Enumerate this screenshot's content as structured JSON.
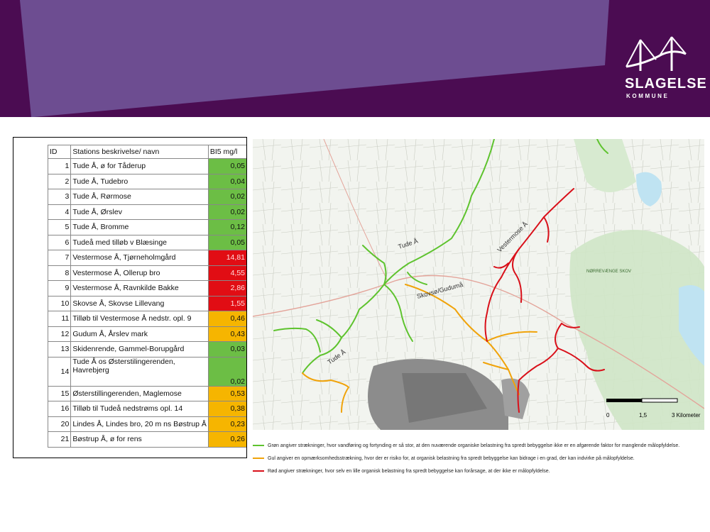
{
  "brand": {
    "name": "SLAGELSE",
    "sub": "KOMMUNE",
    "colors": {
      "header_dark": "#4b0c52",
      "header_light": "#6d4d91"
    }
  },
  "table": {
    "headers": [
      "ID",
      "Stations beskrivelse/ navn",
      "BI5 mg/l"
    ],
    "rows": [
      {
        "id": "1",
        "desc": "Tude Å, ø for Tåderup",
        "val": "0,05",
        "status": "green"
      },
      {
        "id": "2",
        "desc": "Tude Å, Tudebro",
        "val": "0,04",
        "status": "green"
      },
      {
        "id": "3",
        "desc": "Tude Å, Rørmose",
        "val": "0,02",
        "status": "green"
      },
      {
        "id": "4",
        "desc": "Tude Å, Ørslev",
        "val": "0,02",
        "status": "green"
      },
      {
        "id": "5",
        "desc": "Tude Å, Bromme",
        "val": "0,12",
        "status": "green"
      },
      {
        "id": "6",
        "desc": "Tudeå med tilløb v Blæsinge",
        "val": "0,05",
        "status": "green"
      },
      {
        "id": "7",
        "desc": "Vestermose Å, Tjørneholmgård",
        "val": "14,81",
        "status": "red"
      },
      {
        "id": "8",
        "desc": "Vestermose Å, Ollerup bro",
        "val": "4,55",
        "status": "red"
      },
      {
        "id": "9",
        "desc": "Vestermose Å, Ravnkilde Bakke",
        "val": "2,86",
        "status": "red"
      },
      {
        "id": "10",
        "desc": "Skovse Å, Skovse Lillevang",
        "val": "1,55",
        "status": "red"
      },
      {
        "id": "11",
        "desc": "Tilløb til Vestermose Å nedstr. opl. 9",
        "val": "0,46",
        "status": "yellow"
      },
      {
        "id": "12",
        "desc": "Gudum Å, Årslev mark",
        "val": "0,43",
        "status": "yellow"
      },
      {
        "id": "13",
        "desc": "Skidenrende, Gammel-Borupgård",
        "val": "0,03",
        "status": "green"
      },
      {
        "id": "14",
        "desc": "Tude Å os Østerstilingerenden,",
        "desc2": "Havrebjerg",
        "val": "0,02",
        "status": "green"
      },
      {
        "id": "15",
        "desc": "Østerstillingerenden, Maglemose",
        "val": "0,53",
        "status": "yellow"
      },
      {
        "id": "16",
        "desc": "Tilløb til Tudeå nedstrøms opl. 14",
        "val": "0,38",
        "status": "yellow"
      },
      {
        "id": "20",
        "desc": "Lindes Å, Lindes bro, 20 m ns Bøstrup Å",
        "val": "0,23",
        "status": "yellow"
      },
      {
        "id": "21",
        "desc": "Bøstrup Å, ø for rens",
        "val": "0,26",
        "status": "yellow"
      }
    ]
  },
  "map": {
    "labels": {
      "tude1": "Tude Å",
      "tude2": "Tude Å",
      "vestermose": "Vestermose Å",
      "skovse": "Skovsø/Gudumå",
      "forest": "NØRREVÆNGE SKOV"
    },
    "scale": {
      "t0": "0",
      "t1": "1,5",
      "t2": "3 Kilometer"
    },
    "line_colors": {
      "green": "#5ec32e",
      "yellow": "#f0a30a",
      "red": "#d9101a"
    }
  },
  "legend": {
    "green": "Grøn angiver strækninger, hvor vandføring og fortynding er så stor, at den nuværende organiske belastning fra spredt bebyggelse ikke er en afgørende faktor for manglende målopfyldelse.",
    "yellow": "Gul angiver en opmærksomhedsstrækning, hvor der er risiko for, at organisk belastning fra spredt bebyggelse kan bidrage i en grad, der kan indvirke på målopfyldelse.",
    "red": "Rød angiver strækninger, hvor selv en lille organisk belastning fra spredt bebyggelse kan forårsage, at der ikke er målopfyldelse."
  }
}
